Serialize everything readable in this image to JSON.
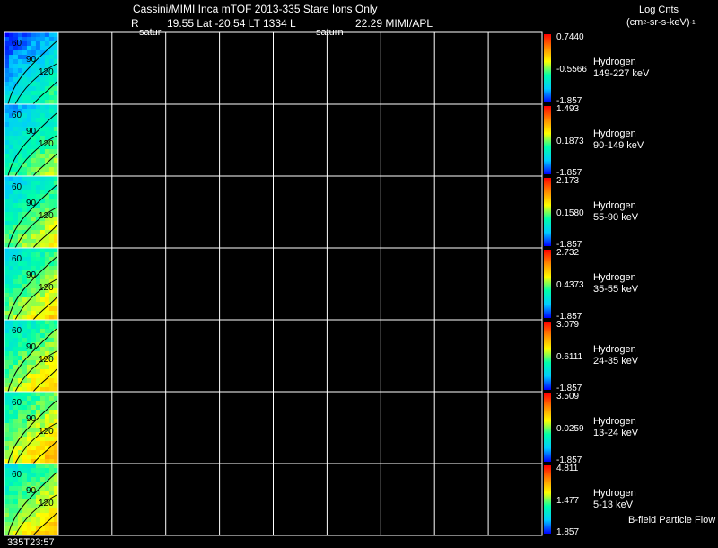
{
  "header": {
    "title": "Cassini/MIMI Inca mTOF  2013-335   Stare   Ions Only",
    "r_label": "R",
    "r_sub": "satur",
    "info_line": "19.55 Lat -20.54 LT 1334 L",
    "l_sub": "saturn",
    "info_tail": "22.29  MIMI/APL",
    "units_line1": "Log Cnts",
    "units_line2_a": "(cm",
    "units_line2_sup": "2",
    "units_line2_b": "-sr-s-keV)",
    "units_line2_sup2": "-1"
  },
  "footer": {
    "time_label": "335T23:57",
    "flow_label": "B-field Particle Flow"
  },
  "colors": {
    "background": "#000000",
    "grid": "#ffffff",
    "colormap": [
      "#0000ff",
      "#00ccff",
      "#00ffaa",
      "#ffff00",
      "#ff8800",
      "#ff0000"
    ]
  },
  "chart_data": {
    "type": "heatmap",
    "num_panels": 7,
    "time_columns": 9,
    "contour_labels": [
      "60",
      "90",
      "120"
    ],
    "panels": [
      {
        "species": "Hydrogen",
        "energy": "149-227 keV",
        "cbar_max": "0.7440",
        "cbar_mid": "-0.5566",
        "cbar_min": "-1.857",
        "fill_level": 0.35
      },
      {
        "species": "Hydrogen",
        "energy": "90-149 keV",
        "cbar_max": "1.493",
        "cbar_mid": "0.1873",
        "cbar_min": "-1.857",
        "fill_level": 0.55
      },
      {
        "species": "Hydrogen",
        "energy": "55-90 keV",
        "cbar_max": "2.173",
        "cbar_mid": "0.1580",
        "cbar_min": "-1.857",
        "fill_level": 0.65
      },
      {
        "species": "Hydrogen",
        "energy": "35-55 keV",
        "cbar_max": "2.732",
        "cbar_mid": "0.4373",
        "cbar_min": "-1.857",
        "fill_level": 0.72
      },
      {
        "species": "Hydrogen",
        "energy": "24-35 keV",
        "cbar_max": "3.079",
        "cbar_mid": "0.6111",
        "cbar_min": "-1.857",
        "fill_level": 0.75
      },
      {
        "species": "Hydrogen",
        "energy": "13-24 keV",
        "cbar_max": "3.509",
        "cbar_mid": "0.0259",
        "cbar_min": "-1.857",
        "fill_level": 0.82
      },
      {
        "species": "Hydrogen",
        "energy": "5-13 keV",
        "cbar_max": "4.811",
        "cbar_mid": "1.477",
        "cbar_min": "1.857",
        "fill_level": 0.78
      }
    ]
  }
}
